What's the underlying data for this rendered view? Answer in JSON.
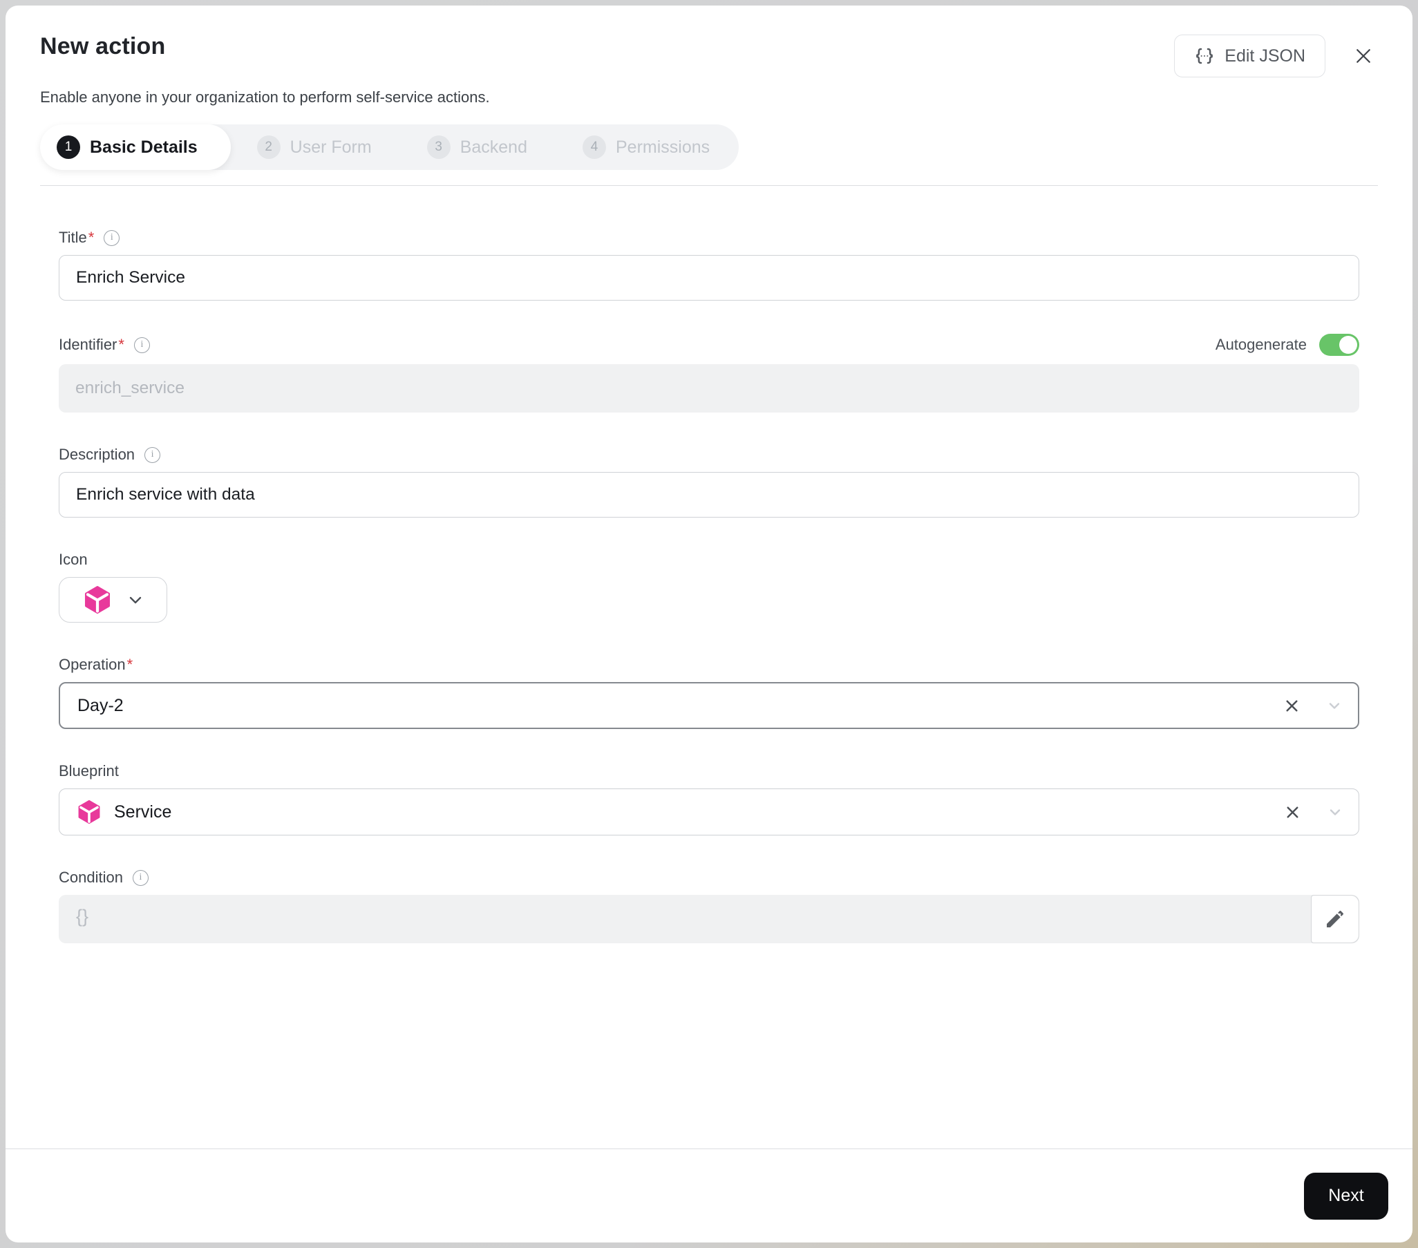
{
  "header": {
    "title": "New action",
    "subtitle": "Enable anyone in your organization to perform self-service actions.",
    "edit_json_label": "Edit JSON"
  },
  "stepper": {
    "steps": [
      {
        "number": "1",
        "label": "Basic Details",
        "active": true
      },
      {
        "number": "2",
        "label": "User Form",
        "active": false
      },
      {
        "number": "3",
        "label": "Backend",
        "active": false
      },
      {
        "number": "4",
        "label": "Permissions",
        "active": false
      }
    ]
  },
  "form": {
    "title": {
      "label": "Title",
      "required": "*",
      "value": "Enrich Service"
    },
    "identifier": {
      "label": "Identifier",
      "required": "*",
      "value": "enrich_service",
      "autogenerate_label": "Autogenerate",
      "autogenerate_on": true
    },
    "description": {
      "label": "Description",
      "value": "Enrich service with data"
    },
    "icon": {
      "label": "Icon",
      "selected_icon": "cube-icon"
    },
    "operation": {
      "label": "Operation",
      "required": "*",
      "value": "Day-2"
    },
    "blueprint": {
      "label": "Blueprint",
      "value": "Service",
      "value_icon": "cube-icon"
    },
    "condition": {
      "label": "Condition",
      "placeholder": "{}"
    }
  },
  "footer": {
    "next_label": "Next"
  },
  "colors": {
    "accent_pink": "#e8399b",
    "toggle_green": "#68c468",
    "next_button": "#0e0f12",
    "active_step": "#17191e"
  }
}
